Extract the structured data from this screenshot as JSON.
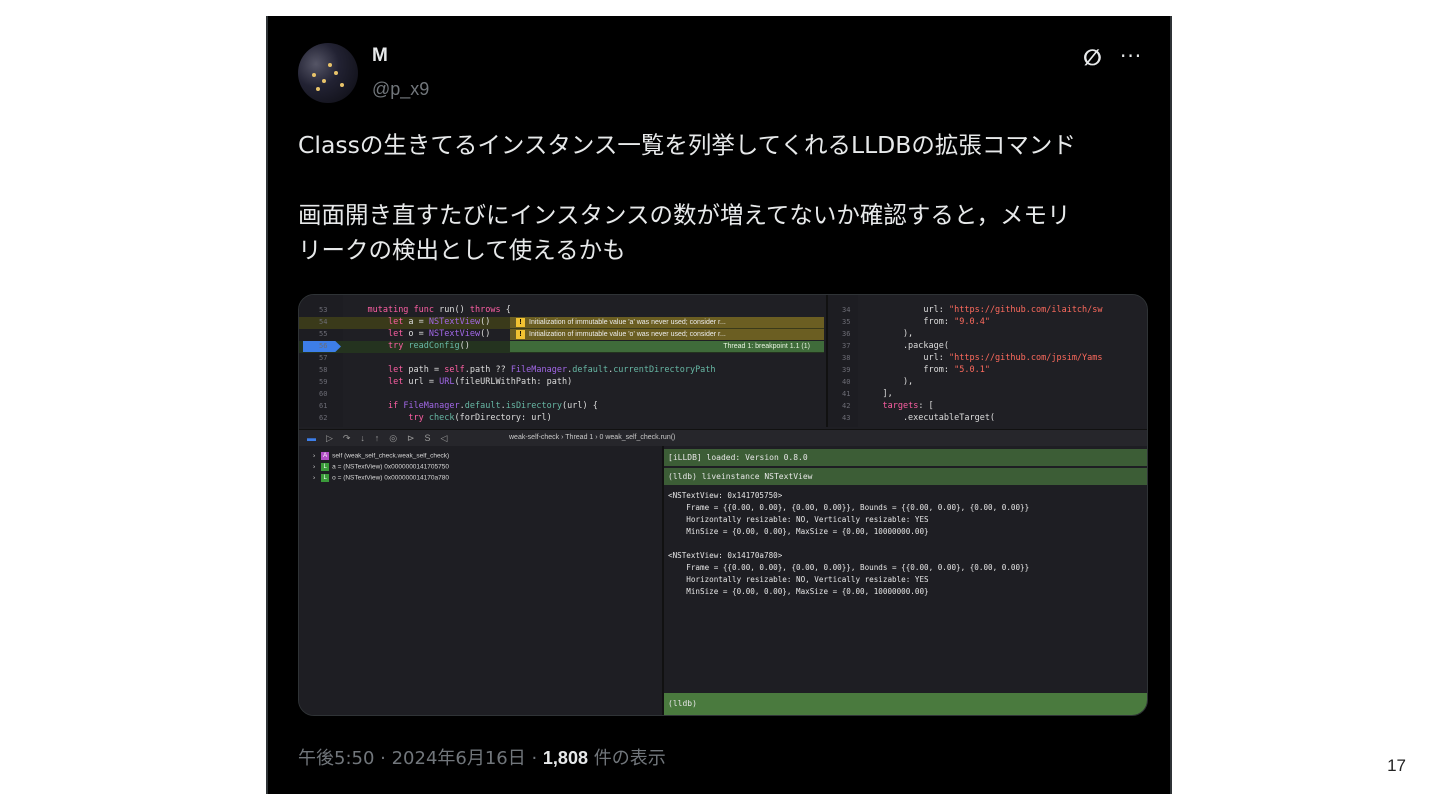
{
  "slide": {
    "number": "17"
  },
  "tweet": {
    "name": "M",
    "handle": "@p_x9",
    "line1": "Classの生きてるインスタンス一覧を列挙してくれるLLDBの拡張コマンド",
    "line2": "画面開き直すたびにインスタンスの数が増えてないか確認すると，メモリ",
    "line3": "リークの検出として使えるかも",
    "time": "午後5:50 · 2024年6月16日 · ",
    "views": "1,808",
    "views_suffix": " 件の表示",
    "grok_icon": "∅",
    "more_icon": "···"
  },
  "editor": {
    "lines": [
      {
        "n": "53",
        "code": "    mutating func run() throws {"
      },
      {
        "n": "54",
        "code": "        let a = NSTextView()"
      },
      {
        "n": "55",
        "code": "        let o = NSTextView()"
      },
      {
        "n": "56",
        "code": "        try readConfig()"
      },
      {
        "n": "57",
        "code": ""
      },
      {
        "n": "58",
        "code": "        let path = self.path ?? FileManager.default.currentDirectoryPath"
      },
      {
        "n": "59",
        "code": "        let url = URL(fileURLWithPath: path)"
      },
      {
        "n": "60",
        "code": ""
      },
      {
        "n": "61",
        "code": "        if FileManager.default.isDirectory(url) {"
      },
      {
        "n": "62",
        "code": "            try check(forDirectory: url)"
      }
    ],
    "warning1": "Initialization of immutable value 'a' was never used; consider r...",
    "warning2": "Initialization of immutable value 'o' was never used; consider r...",
    "breakpoint": "Thread 1: breakpoint 1.1 (1)"
  },
  "editor_right": {
    "lines": [
      {
        "n": "34",
        "code": "            url: \"https://github.com/ilaitch/sw"
      },
      {
        "n": "35",
        "code": "            from: \"9.0.4\""
      },
      {
        "n": "36",
        "code": "        ),"
      },
      {
        "n": "37",
        "code": "        .package("
      },
      {
        "n": "38",
        "code": "            url: \"https://github.com/jpsim/Yams"
      },
      {
        "n": "39",
        "code": "            from: \"5.0.1\""
      },
      {
        "n": "40",
        "code": "        ),"
      },
      {
        "n": "41",
        "code": "    ],"
      },
      {
        "n": "42",
        "code": "    targets: ["
      },
      {
        "n": "43",
        "code": "        .executableTarget("
      }
    ]
  },
  "debug_toolbar": {
    "crumbs": "weak-self-check  ›  Thread 1  ›  0 weak_self_check.run()"
  },
  "variables": [
    {
      "tag": "A",
      "color": "#b04fc4",
      "text": "self (weak_self_check.weak_self_check)"
    },
    {
      "tag": "L",
      "color": "#3a9a3a",
      "text": "a = (NSTextView) 0x0000000141705750"
    },
    {
      "tag": "L",
      "color": "#3a9a3a",
      "text": "o = (NSTextView) 0x000000014170a780"
    }
  ],
  "console": {
    "loaded": "[iLLDB] loaded: Version 0.8.0",
    "command": "(lldb) liveinstance NSTextView",
    "output": "<NSTextView: 0x141705750>\n    Frame = {{0.00, 0.00}, {0.00, 0.00}}, Bounds = {{0.00, 0.00}, {0.00, 0.00}}\n    Horizontally resizable: NO, Vertically resizable: YES\n    MinSize = {0.00, 0.00}, MaxSize = {0.00, 10000000.00}\n\n<NSTextView: 0x14170a780>\n    Frame = {{0.00, 0.00}, {0.00, 0.00}}, Bounds = {{0.00, 0.00}, {0.00, 0.00}}\n    Horizontally resizable: NO, Vertically resizable: YES\n    MinSize = {0.00, 0.00}, MaxSize = {0.00, 10000000.00}",
    "prompt": "(lldb)"
  }
}
